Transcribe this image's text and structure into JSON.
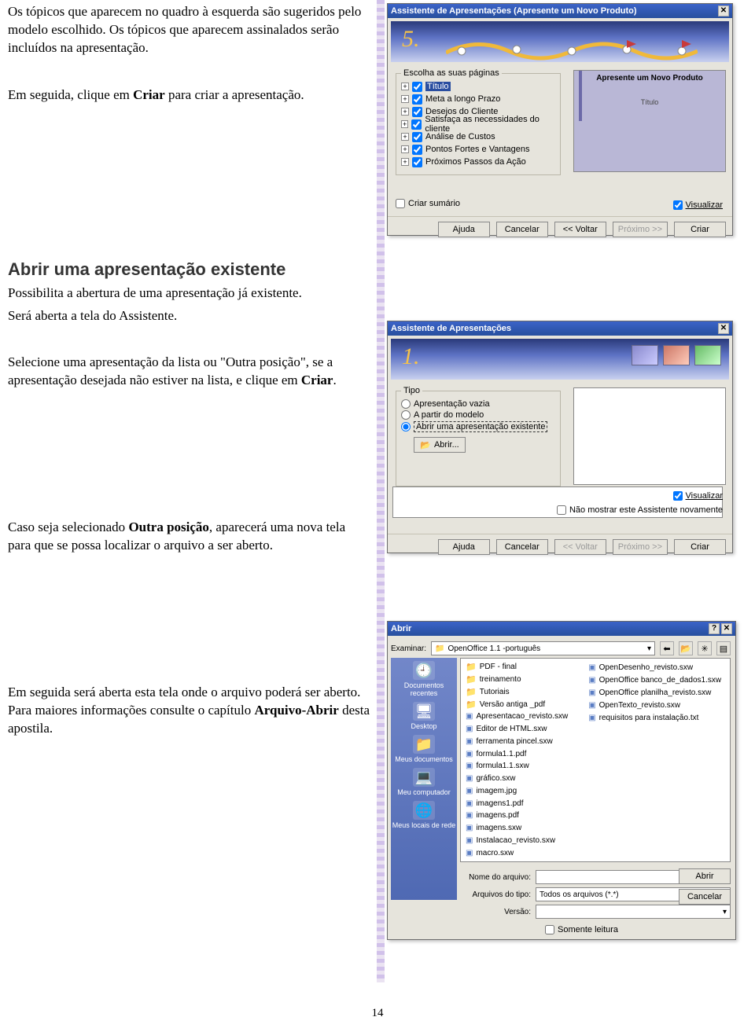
{
  "text": {
    "p1a": "Os tópicos que aparecem no quadro à esquerda são sugeridos pelo modelo escolhido. Os tópicos que aparecem assinalados serão incluídos na apresentação.",
    "p1b_pre": "Em seguida, clique em ",
    "p1b_bold": "Criar",
    "p1b_post": " para criar a apresentação.",
    "h2": "Abrir uma apresentação existente",
    "p2a": "Possibilita a abertura de uma apresentação já existente.",
    "p2b": "Será aberta a tela do Assistente.",
    "p3_pre": "Selecione uma apresentação da lista ou \"Outra posição\", se a apresentação desejada não estiver na lista, e clique em ",
    "p3_bold": "Criar",
    "p3_post": ".",
    "p4_pre": "Caso seja selecionado ",
    "p4_bold": "Outra posição",
    "p4_post": ", aparecerá uma nova tela para que se possa localizar o arquivo a ser aberto.",
    "p5_pre": "Em seguida será aberta esta tela onde o arquivo poderá ser aberto. Para maiores informações consulte o capítulo ",
    "p5_bold": "Arquivo-Abrir",
    "p5_post": " desta apostila.",
    "page_num": "14"
  },
  "dlg1": {
    "title": "Assistente de Apresentações (Apresente um Novo Produto)",
    "step_num": "5.",
    "group_label": "Escolha as suas páginas",
    "tree": [
      "Título",
      "Meta a longo Prazo",
      "Desejos do Cliente",
      "Satisfaça as necessidades do cliente",
      "Análise de Custos",
      "Pontos Fortes e Vantagens",
      "Próximos Passos da Ação"
    ],
    "preview_title": "Apresente um Novo Produto",
    "preview_sub": "Título",
    "visualizar": "Visualizar",
    "criar_sumario": "Criar sumário",
    "buttons": {
      "ajuda": "Ajuda",
      "cancelar": "Cancelar",
      "voltar": "<< Voltar",
      "proximo": "Próximo >>",
      "criar": "Criar"
    }
  },
  "dlg2": {
    "title": "Assistente de Apresentações",
    "step_num": "1.",
    "group_label": "Tipo",
    "radios": {
      "vazia": "Apresentação vazia",
      "modelo": "A partir do modelo",
      "abrir": "Abrir uma apresentação existente"
    },
    "btn_abrir": "Abrir...",
    "visualizar": "Visualizar",
    "nao_mostrar": "Não mostrar este Assistente novamente",
    "buttons": {
      "ajuda": "Ajuda",
      "cancelar": "Cancelar",
      "voltar": "<< Voltar",
      "proximo": "Próximo >>",
      "criar": "Criar"
    }
  },
  "dlg3": {
    "title": "Abrir",
    "examinar_label": "Examinar:",
    "examinar_value": "OpenOffice 1.1 -português",
    "sidebar": [
      "Documentos recentes",
      "Desktop",
      "Meus documentos",
      "Meu computador",
      "Meus locais de rede"
    ],
    "files_left": [
      {
        "t": "folder",
        "name": "PDF - final"
      },
      {
        "t": "folder",
        "name": "treinamento"
      },
      {
        "t": "folder",
        "name": "Tutoriais"
      },
      {
        "t": "folder",
        "name": "Versão antiga _pdf"
      },
      {
        "t": "file",
        "name": "Apresentacao_revisto.sxw"
      },
      {
        "t": "file",
        "name": "Editor de HTML.sxw"
      },
      {
        "t": "file",
        "name": "ferramenta pincel.sxw"
      },
      {
        "t": "file",
        "name": "formula1.1.pdf"
      },
      {
        "t": "file",
        "name": "formula1.1.sxw"
      },
      {
        "t": "file",
        "name": "gráfico.sxw"
      },
      {
        "t": "file",
        "name": "imagem.jpg"
      },
      {
        "t": "file",
        "name": "imagens1.pdf"
      },
      {
        "t": "file",
        "name": "imagens.pdf"
      },
      {
        "t": "file",
        "name": "imagens.sxw"
      },
      {
        "t": "file",
        "name": "Instalacao_revisto.sxw"
      },
      {
        "t": "file",
        "name": "macro.sxw"
      }
    ],
    "files_right": [
      {
        "t": "file",
        "name": "OpenDesenho_revisto.sxw"
      },
      {
        "t": "file",
        "name": "OpenOffice banco_de_dados1.sxw"
      },
      {
        "t": "file",
        "name": "OpenOffice planilha_revisto.sxw"
      },
      {
        "t": "file",
        "name": "OpenTexto_revisto.sxw"
      },
      {
        "t": "file",
        "name": "requisitos para instalação.txt"
      }
    ],
    "nome_label": "Nome do arquivo:",
    "tipo_label": "Arquivos do tipo:",
    "tipo_value": "Todos os arquivos (*.*)",
    "versao_label": "Versão:",
    "btn_abrir": "Abrir",
    "btn_cancelar": "Cancelar",
    "somente_leitura": "Somente leitura"
  }
}
